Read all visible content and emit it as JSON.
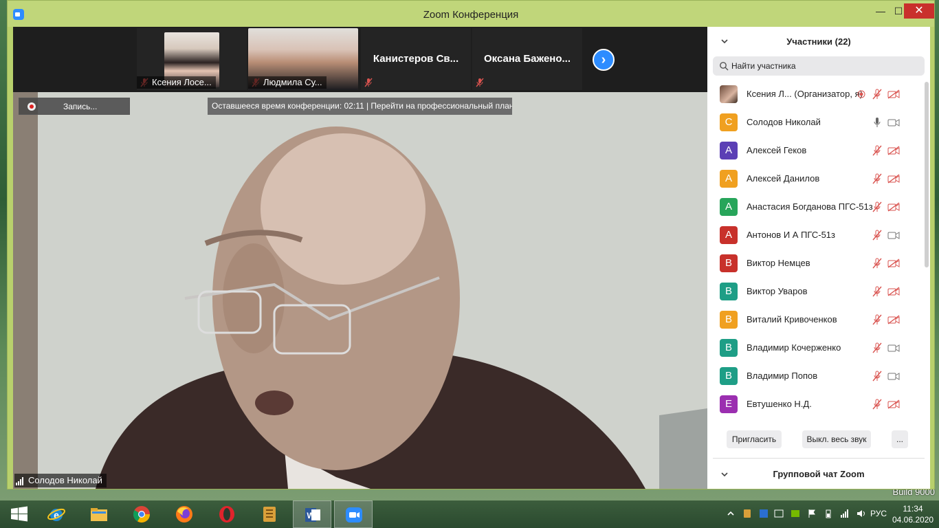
{
  "window": {
    "title": "Zoom Конференция",
    "min_glyph": "—",
    "max_glyph": "☐",
    "close_glyph": "✕"
  },
  "thumbnails": [
    {
      "name": "Ксения Лосе...",
      "type": "video",
      "muted": true
    },
    {
      "name": "Людмила Су...",
      "type": "video",
      "muted": true
    },
    {
      "name": "Канистеров  Св...",
      "type": "name",
      "muted": true
    },
    {
      "name": "Оксана  Бажено...",
      "type": "name",
      "muted": true
    }
  ],
  "next_button": "›",
  "recording": {
    "label": "Запись..."
  },
  "banner": {
    "text": "Оставшееся время конференции: 02:11 | Перейти на профессиональный план"
  },
  "speaker": {
    "name": "Солодов Николай"
  },
  "participants_panel": {
    "title": "Участники (22)",
    "search_placeholder": "Найти участника",
    "items": [
      {
        "initial": "",
        "name": "Ксения Л...  (Организатор, я)",
        "color": "",
        "photo": true,
        "mic": "muted",
        "video": "off",
        "recording": true
      },
      {
        "initial": "С",
        "name": "Солодов Николай",
        "color": "#f0a020",
        "mic": "on",
        "video": "on"
      },
      {
        "initial": "А",
        "name": "Алексей Геков",
        "color": "#5b3fb5",
        "mic": "muted",
        "video": "off"
      },
      {
        "initial": "А",
        "name": "Алексей Данилов",
        "color": "#f0a020",
        "mic": "muted",
        "video": "off"
      },
      {
        "initial": "А",
        "name": "Анастасия Богданова ПГС-51з",
        "color": "#27a55a",
        "mic": "muted",
        "video": "off"
      },
      {
        "initial": "А",
        "name": "Антонов И А ПГС-51з",
        "color": "#c8312b",
        "mic": "muted",
        "video": "on"
      },
      {
        "initial": "В",
        "name": "Виктор Немцев",
        "color": "#c8312b",
        "mic": "muted",
        "video": "off"
      },
      {
        "initial": "В",
        "name": "Виктор Уваров",
        "color": "#1e9e86",
        "mic": "muted",
        "video": "off"
      },
      {
        "initial": "В",
        "name": "Виталий Кривоченков",
        "color": "#f0a020",
        "mic": "muted",
        "video": "off"
      },
      {
        "initial": "В",
        "name": "Владимир Кочерженко",
        "color": "#1e9e86",
        "mic": "muted",
        "video": "on"
      },
      {
        "initial": "В",
        "name": "Владимир Попов",
        "color": "#1e9e86",
        "mic": "muted",
        "video": "on"
      },
      {
        "initial": "Е",
        "name": "Евтушенко Н.Д.",
        "color": "#9b2fb0",
        "mic": "muted",
        "video": "off"
      }
    ],
    "invite_label": "Пригласить",
    "mute_all_label": "Выкл. весь звук",
    "more_label": "..."
  },
  "chat": {
    "title": "Групповой чат Zoom"
  },
  "taskbar": {
    "items": [
      "start",
      "internet-explorer",
      "file-explorer",
      "chrome",
      "firefox",
      "opera",
      "archive",
      "word",
      "zoom"
    ],
    "active": "zoom",
    "lang": "РУС",
    "time": "11:34",
    "date": "04.06.2020"
  },
  "desktop": {
    "watermark": "Build 9000"
  },
  "colors": {
    "accent": "#2d8cff",
    "muted_red": "#d9534f",
    "title_bar": "#c0d67a"
  }
}
